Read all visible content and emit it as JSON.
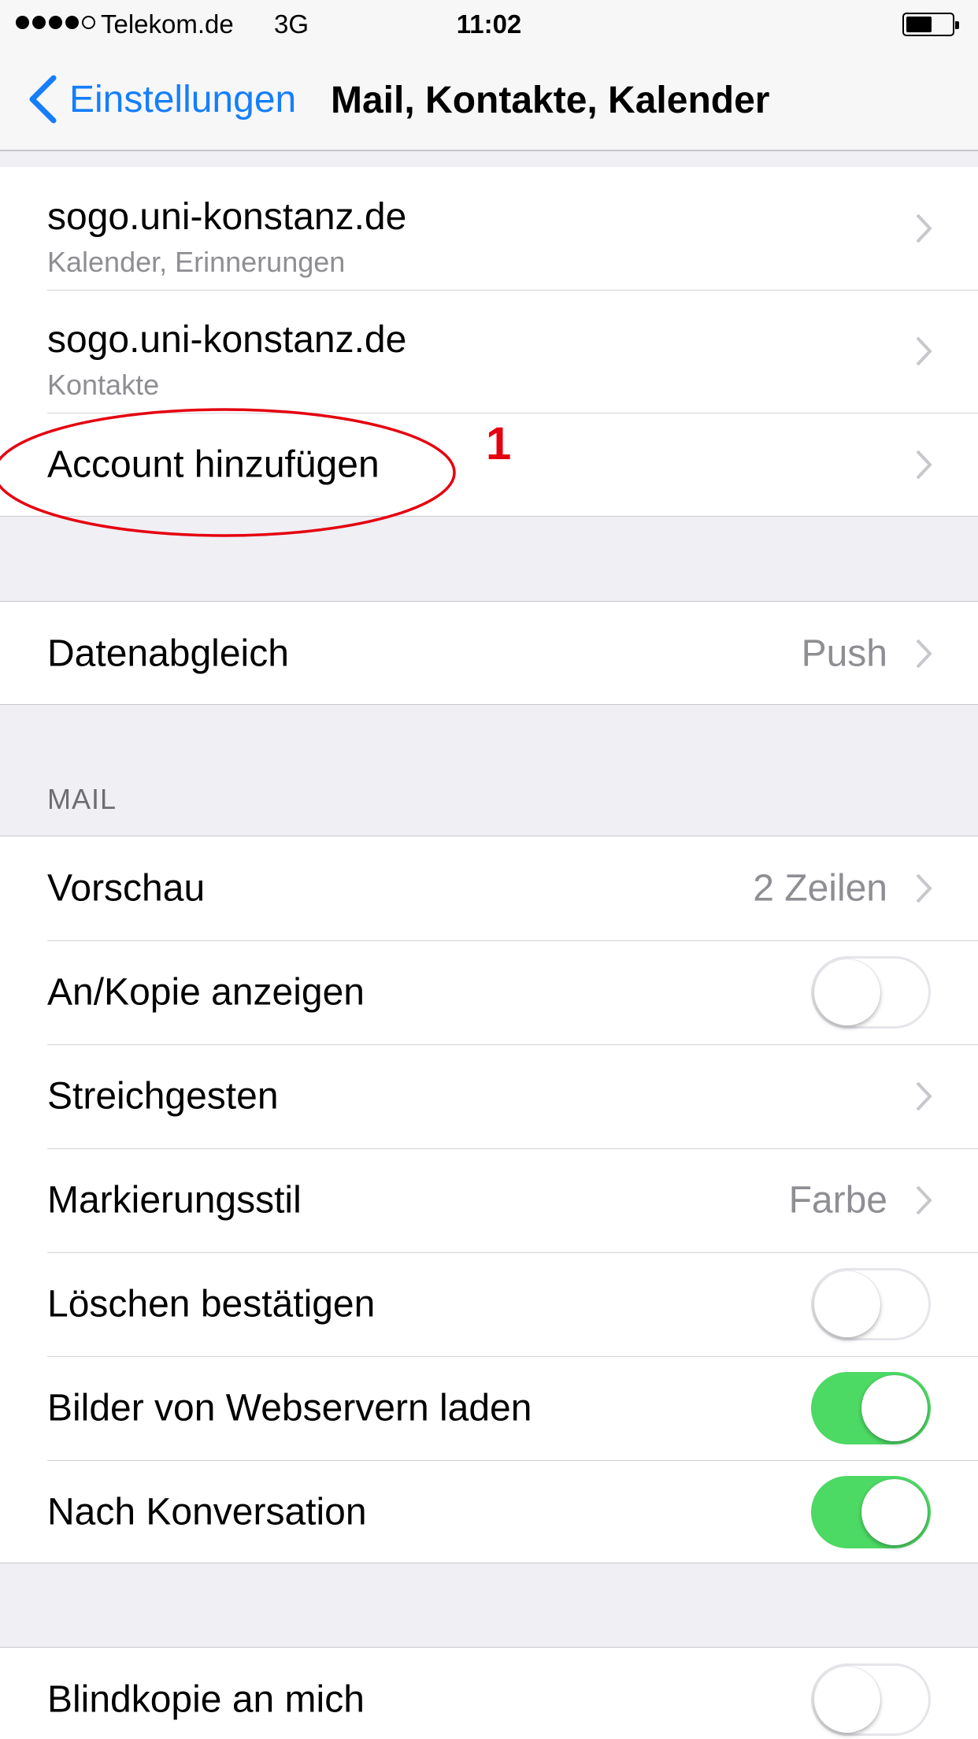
{
  "status_bar": {
    "carrier": "Telekom.de",
    "network": "3G",
    "time": "11:02",
    "battery_level": 0.58
  },
  "nav": {
    "back_label": "Einstellungen",
    "title": "Mail, Kontakte, Kalender",
    "accent_color": "#157efb"
  },
  "accounts": [
    {
      "title": "sogo.uni-konstanz.de",
      "subtitle": "Kalender, Erinnerungen"
    },
    {
      "title": "sogo.uni-konstanz.de",
      "subtitle": "Kontakte"
    }
  ],
  "add_account_label": "Account hinzufügen",
  "annotation": {
    "number": "1",
    "color": "#e5000f"
  },
  "fetch": {
    "label": "Datenabgleich",
    "value": "Push"
  },
  "mail_section": {
    "header": "MAIL",
    "preview": {
      "label": "Vorschau",
      "value": "2 Zeilen"
    },
    "show_to_cc": {
      "label": "An/Kopie anzeigen",
      "on": false
    },
    "swipe": {
      "label": "Streichgesten"
    },
    "flag_style": {
      "label": "Markierungsstil",
      "value": "Farbe"
    },
    "ask_before_delete": {
      "label": "Löschen bestätigen",
      "on": false
    },
    "load_remote_images": {
      "label": "Bilder von Webservern laden",
      "on": true
    },
    "organize_by_thread": {
      "label": "Nach Konversation",
      "on": true
    }
  },
  "bcc": {
    "label": "Blindkopie an mich",
    "on": false
  },
  "toggle_on_color": "#4cd964"
}
